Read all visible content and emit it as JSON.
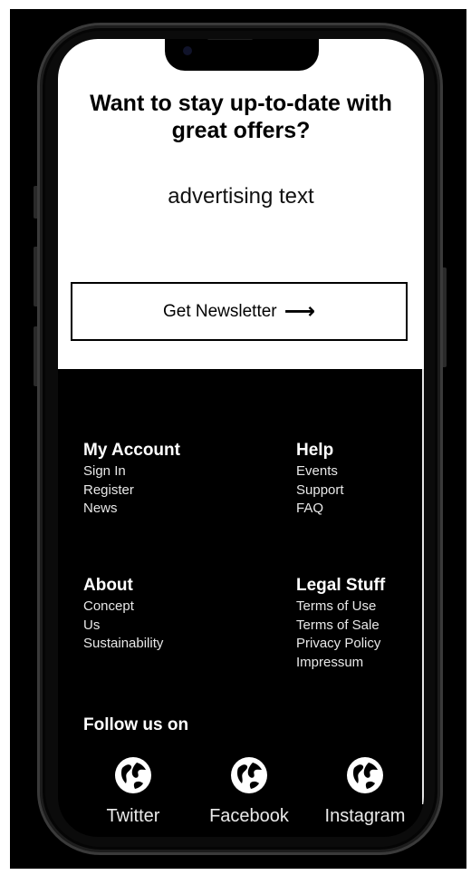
{
  "hero": {
    "title": "Want to stay up-to-date with great offers?",
    "text": "advertising text",
    "cta_label": "Get Newsletter",
    "cta_icon": "arrow-right-icon"
  },
  "footer": {
    "columns": [
      {
        "heading": "My Account",
        "links": [
          "Sign In",
          "Register",
          "News"
        ]
      },
      {
        "heading": "Help",
        "links": [
          "Events",
          "Support",
          "FAQ"
        ]
      },
      {
        "heading": "About",
        "links": [
          "Concept",
          "Us",
          "Sustainability"
        ]
      },
      {
        "heading": "Legal Stuff",
        "links": [
          "Terms of Use",
          "Terms of Sale",
          "Privacy Policy",
          "Impressum"
        ]
      }
    ],
    "follow_heading": "Follow us on",
    "social": [
      {
        "label": "Twitter",
        "icon": "globe-icon"
      },
      {
        "label": "Facebook",
        "icon": "globe-icon"
      },
      {
        "label": "Instagram",
        "icon": "globe-icon"
      }
    ]
  },
  "colors": {
    "background": "#000000",
    "hero_background": "#ffffff",
    "text_light": "#ffffff",
    "text_dark": "#000000"
  }
}
